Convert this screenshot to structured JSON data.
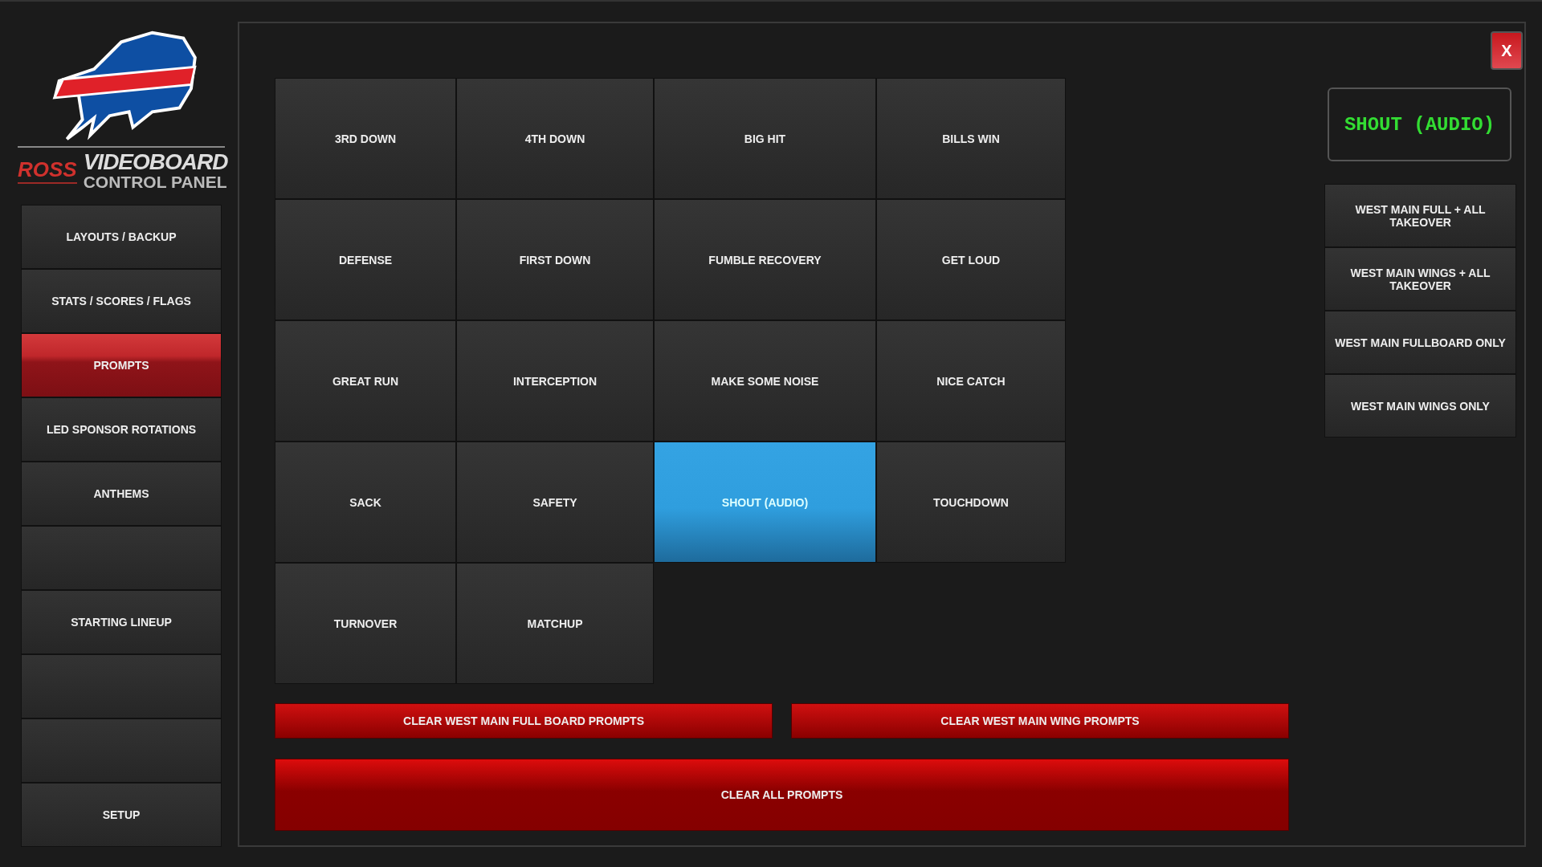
{
  "branding": {
    "brand": "ROSS",
    "title": "VIDEOBOARD",
    "subtitle": "CONTROL PANEL"
  },
  "nav": [
    {
      "label": "LAYOUTS / BACKUP",
      "selected": false
    },
    {
      "label": "STATS / SCORES / FLAGS",
      "selected": false
    },
    {
      "label": "PROMPTS",
      "selected": true
    },
    {
      "label": "LED SPONSOR ROTATIONS",
      "selected": false
    },
    {
      "label": "ANTHEMS",
      "selected": false
    },
    {
      "selected": false
    },
    {
      "label": "STARTING LINEUP",
      "selected": false
    },
    {
      "selected": false
    },
    {
      "selected": false
    },
    {
      "label": "SETUP",
      "selected": false
    }
  ],
  "close_button": "X",
  "prompts": [
    {
      "label": "3RD DOWN",
      "selected": false
    },
    {
      "label": "4TH DOWN",
      "selected": false
    },
    {
      "label": "BIG HIT",
      "selected": false
    },
    {
      "label": "BILLS WIN",
      "selected": false
    },
    {
      "label": "DEFENSE",
      "selected": false
    },
    {
      "label": "FIRST DOWN",
      "selected": false
    },
    {
      "label": "FUMBLE RECOVERY",
      "selected": false
    },
    {
      "label": "GET LOUD",
      "selected": false
    },
    {
      "label": "GREAT RUN",
      "selected": false
    },
    {
      "label": "INTERCEPTION",
      "selected": false
    },
    {
      "label": "MAKE SOME NOISE",
      "selected": false
    },
    {
      "label": "NICE CATCH",
      "selected": false
    },
    {
      "label": "SACK",
      "selected": false
    },
    {
      "label": "SAFETY",
      "selected": false
    },
    {
      "label": "SHOUT (AUDIO)",
      "selected": true
    },
    {
      "label": "TOUCHDOWN",
      "selected": false
    },
    {
      "label": "TURNOVER",
      "selected": false
    },
    {
      "label": "MATCHUP",
      "selected": false
    }
  ],
  "display": "SHOUT (AUDIO)",
  "targets": [
    "WEST MAIN FULL + ALL TAKEOVER",
    "WEST MAIN WINGS + ALL TAKEOVER",
    "WEST MAIN FULLBOARD ONLY",
    "WEST MAIN WINGS ONLY"
  ],
  "clear_buttons": [
    "CLEAR WEST MAIN FULL BOARD PROMPTS",
    "CLEAR WEST MAIN WING PROMPTS"
  ],
  "clear_all": "CLEAR ALL PROMPTS"
}
